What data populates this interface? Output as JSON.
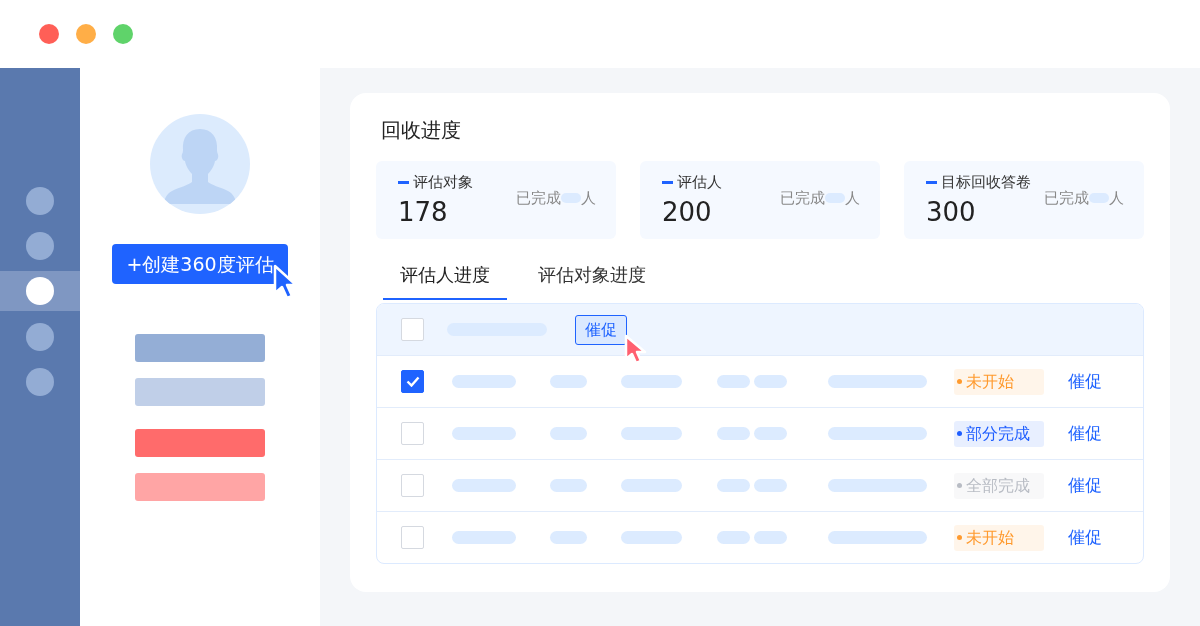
{
  "rail": {
    "items": [
      {
        "selected": false
      },
      {
        "selected": false
      },
      {
        "selected": true
      },
      {
        "selected": false
      },
      {
        "selected": false
      }
    ]
  },
  "create_button": "+创建360度评估",
  "panel": {
    "title": "回收进度",
    "stats": [
      {
        "label": "评估对象",
        "value": "178",
        "done_label": "已完成",
        "unit": "人"
      },
      {
        "label": "评估人",
        "value": "200",
        "done_label": "已完成",
        "unit": "人"
      },
      {
        "label": "目标回收答卷",
        "value": "300",
        "done_label": "已完成",
        "unit": "人"
      }
    ],
    "tabs": [
      {
        "label": "评估人进度",
        "selected": true
      },
      {
        "label": "评估对象进度",
        "selected": false
      }
    ],
    "table": {
      "header": {
        "checked": false,
        "action": "催促"
      },
      "rows": [
        {
          "checked": true,
          "status": "未开始",
          "color": "#ff9a2e",
          "action": "催促"
        },
        {
          "checked": false,
          "status": "部分完成",
          "color": "#1f5eff",
          "action": "催促"
        },
        {
          "checked": false,
          "status": "全部完成",
          "color": "#b8bcc4",
          "action": "催促"
        },
        {
          "checked": false,
          "status": "未开始",
          "color": "#ff9a2e",
          "action": "催促"
        }
      ]
    }
  }
}
